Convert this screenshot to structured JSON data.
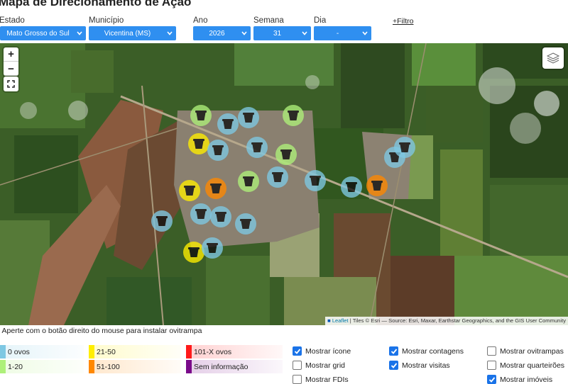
{
  "page": {
    "title": "Mapa de Direcionamento de Ação"
  },
  "filters": {
    "estado": {
      "label": "Estado",
      "value": "Mato Grosso do Sul"
    },
    "municipio": {
      "label": "Município",
      "value": "Vicentina (MS)"
    },
    "ano": {
      "label": "Ano",
      "value": "2026"
    },
    "semana": {
      "label": "Semana",
      "value": "31"
    },
    "dia": {
      "label": "Dia",
      "value": "-"
    },
    "mais_filtro": "+Filtro",
    "color": "#2f8ff0"
  },
  "map": {
    "zoom_in": "+",
    "zoom_out": "−",
    "attribution_link": "Leaflet",
    "attribution_text": "| Tiles © Esri — Source: Esri, Maxar, Earthstar Geographics, and the GIS User Community",
    "markers": [
      {
        "category": "1-20"
      },
      {
        "category": "0 ovos"
      },
      {
        "category": "0 ovos"
      },
      {
        "category": "1-20"
      },
      {
        "category": "21-50"
      },
      {
        "category": "0 ovos"
      },
      {
        "category": "0 ovos"
      },
      {
        "category": "1-20"
      },
      {
        "category": "0 ovos"
      },
      {
        "category": "0 ovos"
      },
      {
        "category": "21-50"
      },
      {
        "category": "51-100"
      },
      {
        "category": "1-20"
      },
      {
        "category": "0 ovos"
      },
      {
        "category": "0 ovos"
      },
      {
        "category": "0 ovos"
      },
      {
        "category": "51-100"
      },
      {
        "category": "0 ovos"
      },
      {
        "category": "0 ovos"
      },
      {
        "category": "0 ovos"
      },
      {
        "category": "0 ovos"
      },
      {
        "category": "21-50"
      },
      {
        "category": "0 ovos"
      }
    ]
  },
  "hint": "° Aperte com o botão direito do mouse para instalar ovitrampa",
  "legend": [
    {
      "label": "0 ovos",
      "color": "#7ec8e3"
    },
    {
      "label": "1-20",
      "color": "#aef07a"
    },
    {
      "label": "21-50",
      "color": "#ffee00"
    },
    {
      "label": "51-100",
      "color": "#ff8800"
    },
    {
      "label": "101-X ovos",
      "color": "#ff1a1a"
    },
    {
      "label": "Sem informação",
      "color": "#7a0a8a"
    }
  ],
  "options": [
    {
      "label": "Mostrar ícone",
      "checked": true
    },
    {
      "label": "Mostrar grid",
      "checked": false
    },
    {
      "label": "Mostrar FDIs",
      "checked": false
    },
    {
      "label": "Mostrar contagens",
      "checked": true
    },
    {
      "label": "Mostrar visitas",
      "checked": true
    },
    {
      "label": "Mostrar ovitrampas",
      "checked": false
    },
    {
      "label": "Mostrar quarteirões",
      "checked": false
    },
    {
      "label": "Mostrar imóveis",
      "checked": true
    }
  ]
}
